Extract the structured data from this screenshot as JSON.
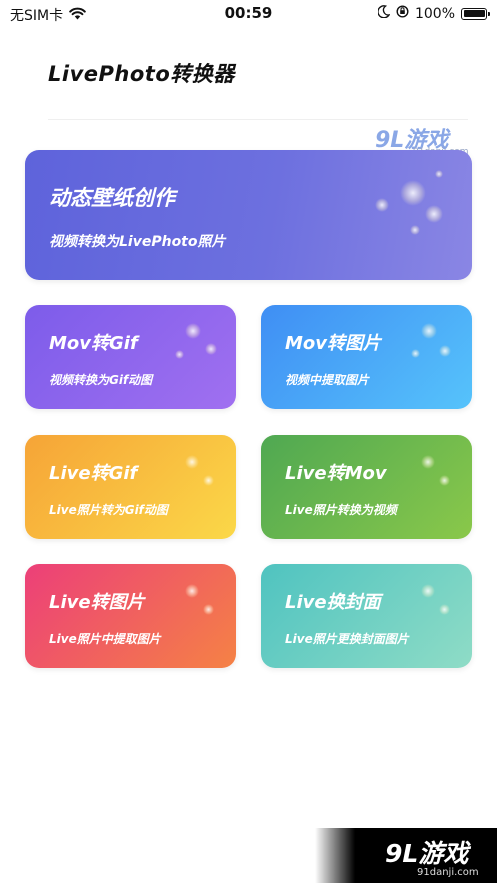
{
  "status_bar": {
    "carrier": "无SIM卡",
    "time": "00:59",
    "battery": "100%",
    "battery_level": 1.0
  },
  "header": {
    "title": "LivePhoto转换器"
  },
  "cards": {
    "main": {
      "title": "动态壁纸创作",
      "subtitle": "视频转换为LivePhoto照片",
      "color": "#5e63db"
    },
    "mov_gif": {
      "title": "Mov转Gif",
      "subtitle": "视频转换为Gif动图",
      "color": "#8a64ee"
    },
    "mov_img": {
      "title": "Mov转图片",
      "subtitle": "视频中提取图片",
      "color": "#4aa8f7"
    },
    "live_gif": {
      "title": "Live转Gif",
      "subtitle": "Live照片转为Gif动图",
      "color": "#f8bd3e"
    },
    "live_mov": {
      "title": "Live转Mov",
      "subtitle": "Live照片转换为视频",
      "color": "#68b74e"
    },
    "live_img": {
      "title": "Live转图片",
      "subtitle": "Live照片中提取图片",
      "color": "#ef5a62"
    },
    "live_cover": {
      "title": "Live换封面",
      "subtitle": "Live照片更换封面图片",
      "color": "#6ccfc2"
    }
  },
  "watermark": {
    "brand": "9L游戏",
    "url": "91danji.com"
  }
}
